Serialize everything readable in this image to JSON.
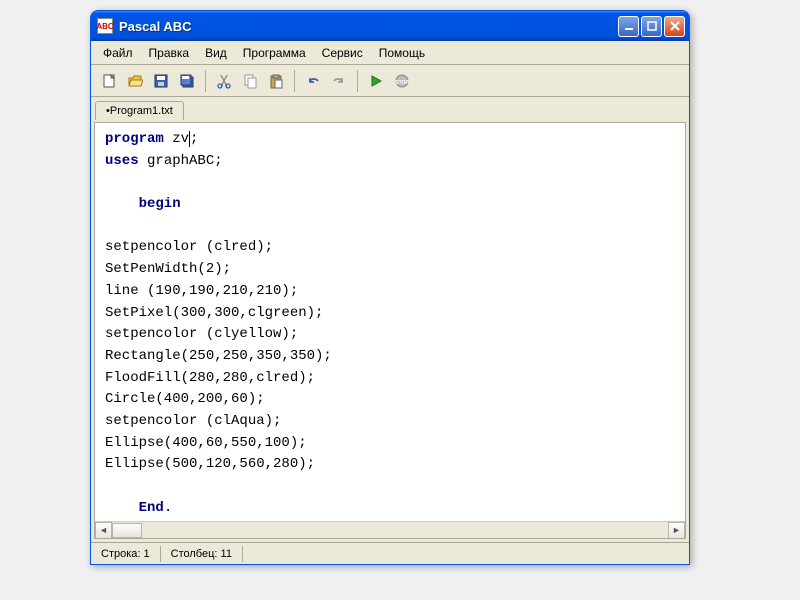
{
  "window": {
    "title": "Pascal ABC",
    "app_icon_label": "ABC"
  },
  "menu": {
    "file": "Файл",
    "edit": "Правка",
    "view": "Вид",
    "program": "Программа",
    "service": "Сервис",
    "help": "Помощь"
  },
  "tabs": {
    "active": "Program1.txt",
    "modified_marker": "•"
  },
  "code": {
    "l1a": "program",
    "l1b": " zv",
    "l1c": ";",
    "l2a": "uses",
    "l2b": " graphABC;",
    "l3": "",
    "l4a": "    begin",
    "l5": "",
    "l6": "setpencolor (clred);",
    "l7": "SetPenWidth(2);",
    "l8": "line (190,190,210,210);",
    "l9": "SetPixel(300,300,clgreen);",
    "l10": "setpencolor (clyellow);",
    "l11": "Rectangle(250,250,350,350);",
    "l12": "FloodFill(280,280,clred);",
    "l13": "Circle(400,200,60);",
    "l14": "setpencolor (clAqua);",
    "l15": "Ellipse(400,60,550,100);",
    "l16": "Ellipse(500,120,560,280);",
    "l17": "",
    "l18a": "    End",
    "l18b": "."
  },
  "status": {
    "line_label": "Строка:",
    "line_value": "1",
    "col_label": "Столбец:",
    "col_value": "11"
  },
  "icons": {
    "new": "new-file-icon",
    "open": "open-folder-icon",
    "save": "save-icon",
    "saveall": "save-all-icon",
    "cut": "cut-icon",
    "copy": "copy-icon",
    "paste": "paste-icon",
    "undo": "undo-icon",
    "redo": "redo-icon",
    "run": "run-icon",
    "stop": "stop-icon"
  }
}
